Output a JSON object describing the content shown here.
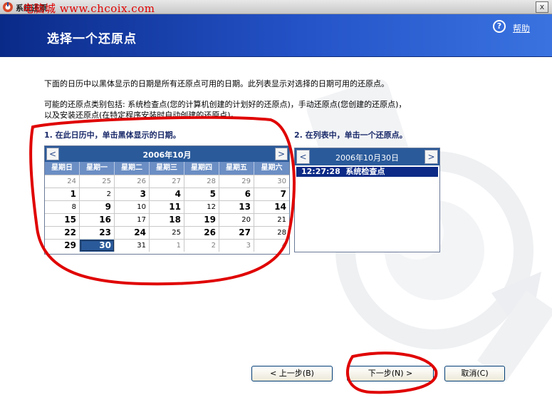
{
  "window": {
    "title": "系统还原",
    "watermark": "电脑城 www.chcoix.com",
    "close_label": "x"
  },
  "header": {
    "title": "选择一个还原点",
    "help_label": "帮助"
  },
  "description": {
    "line1": "下面的日历中以黑体显示的日期是所有还原点可用的日期。此列表显示对选择的日期可用的还原点。",
    "line2": "可能的还原点类别包括: 系统检查点(您的计算机创建的计划好的还原点)，手动还原点(您创建的还原点)，",
    "line3": "以及安装还原点(在特定程序安装时自动创建的还原点)。"
  },
  "step1": {
    "label": "1. 在此日历中，单击黑体显示的日期。"
  },
  "step2": {
    "label": "2. 在列表中，单击一个还原点。"
  },
  "calendar": {
    "month_label": "2006年10月",
    "prev_label": "<",
    "next_label": ">",
    "weekdays": [
      "星期日",
      "星期一",
      "星期二",
      "星期三",
      "星期四",
      "星期五",
      "星期六"
    ],
    "weeks": [
      [
        {
          "d": "24",
          "t": "other"
        },
        {
          "d": "25",
          "t": "other"
        },
        {
          "d": "26",
          "t": "other"
        },
        {
          "d": "27",
          "t": "other"
        },
        {
          "d": "28",
          "t": "other"
        },
        {
          "d": "29",
          "t": "other"
        },
        {
          "d": "30",
          "t": "other"
        }
      ],
      [
        {
          "d": "1",
          "t": "bold"
        },
        {
          "d": "2",
          "t": "normal"
        },
        {
          "d": "3",
          "t": "bold"
        },
        {
          "d": "4",
          "t": "bold"
        },
        {
          "d": "5",
          "t": "bold"
        },
        {
          "d": "6",
          "t": "bold"
        },
        {
          "d": "7",
          "t": "bold"
        }
      ],
      [
        {
          "d": "8",
          "t": "normal"
        },
        {
          "d": "9",
          "t": "bold"
        },
        {
          "d": "10",
          "t": "normal"
        },
        {
          "d": "11",
          "t": "bold"
        },
        {
          "d": "12",
          "t": "normal"
        },
        {
          "d": "13",
          "t": "bold"
        },
        {
          "d": "14",
          "t": "bold"
        }
      ],
      [
        {
          "d": "15",
          "t": "bold"
        },
        {
          "d": "16",
          "t": "bold"
        },
        {
          "d": "17",
          "t": "normal"
        },
        {
          "d": "18",
          "t": "bold"
        },
        {
          "d": "19",
          "t": "bold"
        },
        {
          "d": "20",
          "t": "normal"
        },
        {
          "d": "21",
          "t": "normal"
        }
      ],
      [
        {
          "d": "22",
          "t": "bold"
        },
        {
          "d": "23",
          "t": "bold"
        },
        {
          "d": "24",
          "t": "bold"
        },
        {
          "d": "25",
          "t": "normal"
        },
        {
          "d": "26",
          "t": "bold"
        },
        {
          "d": "27",
          "t": "bold"
        },
        {
          "d": "28",
          "t": "normal"
        }
      ],
      [
        {
          "d": "29",
          "t": "bold"
        },
        {
          "d": "30",
          "t": "selected"
        },
        {
          "d": "31",
          "t": "normal"
        },
        {
          "d": "1",
          "t": "other"
        },
        {
          "d": "2",
          "t": "other"
        },
        {
          "d": "3",
          "t": "other"
        },
        {
          "d": "4",
          "t": "other"
        }
      ]
    ]
  },
  "restore_points": {
    "date_label": "2006年10月30日",
    "prev_label": "<",
    "next_label": ">",
    "items": [
      {
        "time": "12:27:28",
        "label": "系统检查点"
      }
    ]
  },
  "buttons": {
    "back_label": "< 上一步(B)",
    "next_label": "下一步(N) >",
    "cancel_label": "取消(C)"
  },
  "colors": {
    "header_blue": "#2453c8",
    "calendar_blue": "#2a5a9a",
    "selected_item": "#0c2a86",
    "annotation_red": "#e00000"
  }
}
